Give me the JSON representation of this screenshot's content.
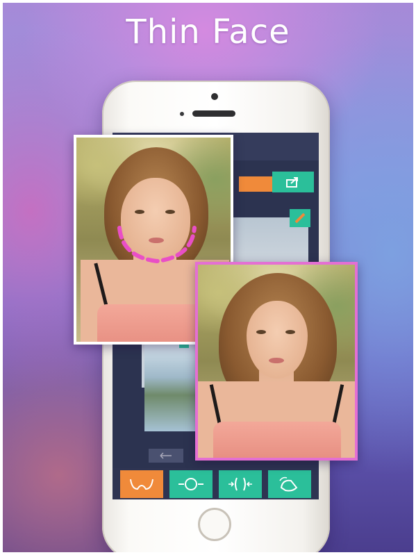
{
  "title": "Thin Face",
  "toolbar": {
    "tools": [
      {
        "icon": "face-contour-icon",
        "state": "active"
      },
      {
        "icon": "face-circle-icon",
        "state": "inactive"
      },
      {
        "icon": "face-slim-icon",
        "state": "inactive"
      },
      {
        "icon": "hand-reshape-icon",
        "state": "inactive"
      }
    ]
  },
  "buttons": {
    "share": {
      "icon": "share-icon"
    },
    "edit": {
      "icon": "edit-icon"
    }
  },
  "colors": {
    "accent_orange": "#f08a3a",
    "accent_teal": "#2bbf9a",
    "after_frame": "#e46fd3",
    "guide_dash": "#e94fc6"
  }
}
